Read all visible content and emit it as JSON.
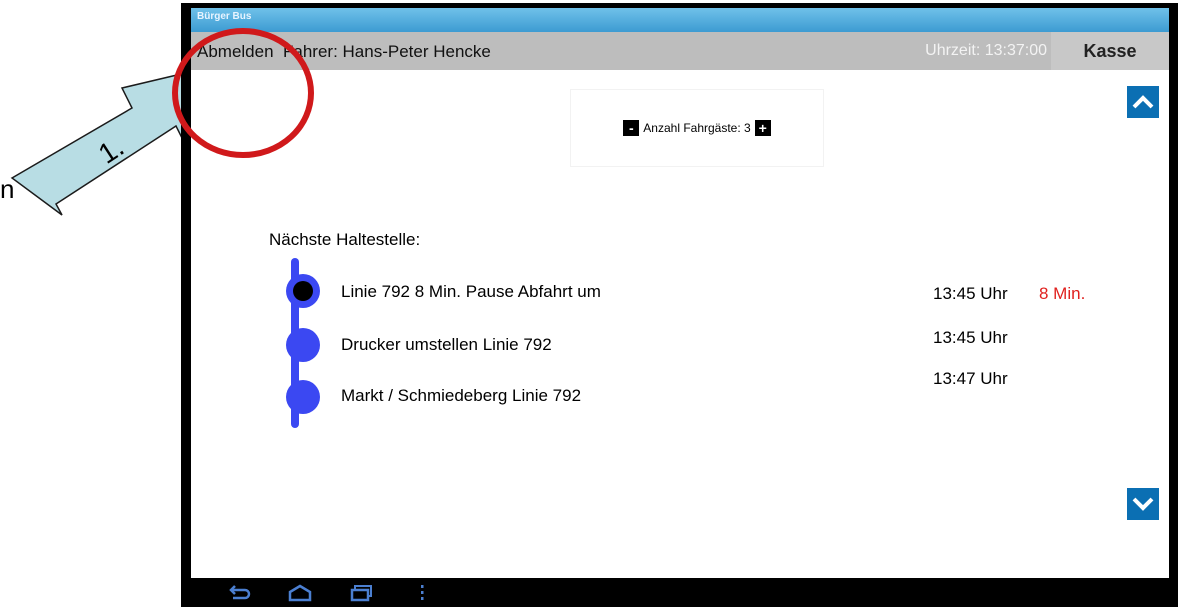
{
  "annotation": {
    "step_label": "1.",
    "left_edge_char": "n"
  },
  "app": {
    "title": "Bürger Bus"
  },
  "topbar": {
    "logout_label": "Abmelden",
    "driver_label": "Fahrer: Hans-Peter Hencke",
    "clock_label": "Uhrzeit: 13:37:00",
    "cash_button_label": "Kasse"
  },
  "passengers": {
    "label": "Anzahl Fahrgäste: 3",
    "minus": "-",
    "plus": "+"
  },
  "next_stop_heading": "Nächste Haltestelle:",
  "stops": [
    {
      "text": "Linie 792  8 Min. Pause   Abfahrt um",
      "time": "13:45 Uhr",
      "wait": "8 Min.",
      "current": true
    },
    {
      "text": "Drucker umstellen Linie 792",
      "time": "13:45 Uhr",
      "wait": "",
      "current": false
    },
    {
      "text": "Markt / Schmiedeberg Linie 792",
      "time": "13:47 Uhr",
      "wait": "",
      "current": false
    }
  ],
  "icons": {
    "scroll_up": "chevron-up-icon",
    "scroll_down": "chevron-down-icon",
    "nav_back": "back-icon",
    "nav_home": "home-icon",
    "nav_recent": "recent-apps-icon",
    "nav_menu": "menu-icon"
  },
  "colors": {
    "timeline": "#3b48f2",
    "wait_highlight": "#e0211e",
    "annotation_circle": "#d0191b",
    "annotation_arrow": "#b8dde4",
    "scroll_button": "#0b6fb3"
  }
}
